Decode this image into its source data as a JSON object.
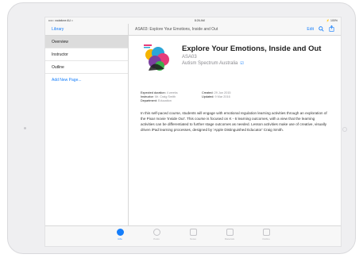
{
  "statusbar": {
    "carrier": "••••○ vodafone AU ≈",
    "time": "8:26 AM",
    "battery": "⚡ 100%"
  },
  "navbar": {
    "back_label": "Library",
    "title": "ASA03: Explore Your Emotions, Inside and Out",
    "edit_label": "Edit"
  },
  "sidebar": {
    "items": [
      {
        "label": "Overview",
        "active": true
      },
      {
        "label": "Instructor",
        "active": false
      },
      {
        "label": "Outline",
        "active": false
      },
      {
        "label": "Add New Page...",
        "active": false
      }
    ]
  },
  "course": {
    "title": "Explore Your Emotions, Inside and Out",
    "code": "ASA03",
    "provider": "Autism Spectrum Australia",
    "meta": {
      "duration_label": "Expected duration:",
      "duration_value": "4 weeks",
      "created_label": "Created:",
      "created_value": "29 Jun 2015",
      "instructor_label": "Instructor:",
      "instructor_value": "Mr. Craig Smith",
      "updated_label": "Updated:",
      "updated_value": "9 Mar 2016",
      "department_label": "Department:",
      "department_value": "Education"
    },
    "description": "In this self-paced course, students will engage with emotional regulation learning activities through an exploration of the Pixar movie 'Inside Out'. This course is focused on K - 6 learning outcomes, with a view that the learning activities can be differentiated to further stage outcomes as needed. Lesson activities make use of creative, visually driven iPad learning processes, designed by 'Apple Distinguished Educator' Craig Smith."
  },
  "tabbar": {
    "items": [
      {
        "label": "Info",
        "icon": "info-icon",
        "active": true
      },
      {
        "label": "Posts",
        "icon": "posts-icon",
        "active": false
      },
      {
        "label": "Notes",
        "icon": "notes-icon",
        "active": false
      },
      {
        "label": "Materials",
        "icon": "materials-icon",
        "active": false
      },
      {
        "label": "Outline",
        "icon": "outline-icon",
        "active": false
      }
    ]
  },
  "colors": {
    "accent": "#157efb",
    "active_row": "#dcdcdc",
    "secondary_text": "#8a8a8f"
  }
}
